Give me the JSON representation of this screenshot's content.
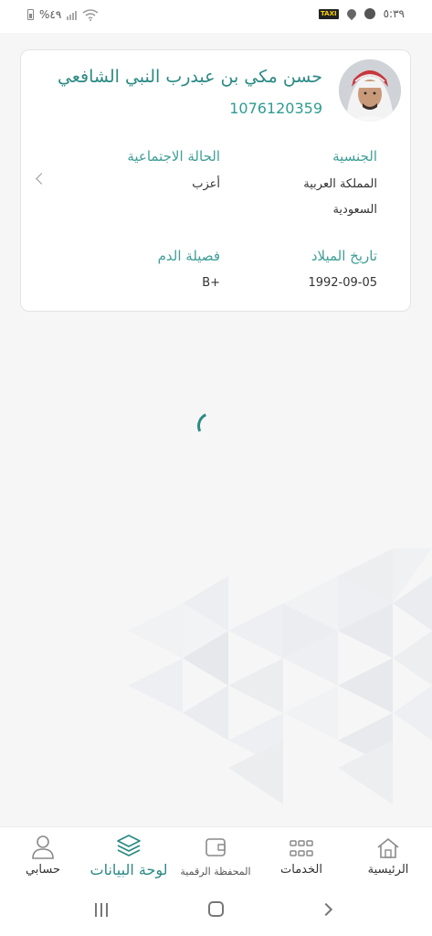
{
  "status_bar": {
    "battery_pct": "%٤٩",
    "time": "٥:٣٩",
    "taxi_badge": "TAXI"
  },
  "profile": {
    "name": "حسن مكي بن عبدرب النبي الشافعي",
    "id_number": "1076120359",
    "nationality_label": "الجنسية",
    "nationality_line1": "المملكة العربية",
    "nationality_line2": "السعودية",
    "marital_label": "الحالة الاجتماعية",
    "marital_value": "أعزب",
    "dob_label": "تاريخ الميلاد",
    "dob_value": "1992-09-05",
    "blood_label": "فصيلة الدم",
    "blood_value": "B+"
  },
  "bottom_nav": {
    "items": [
      {
        "label": "الرئيسية",
        "icon": "home-icon"
      },
      {
        "label": "الخدمات",
        "icon": "grid-icon"
      },
      {
        "label": "المحفظة الرقمية",
        "icon": "wallet-icon"
      },
      {
        "label": "لوحة البيانات",
        "icon": "layers-icon",
        "active": true
      },
      {
        "label": "حسابي",
        "icon": "user-icon"
      }
    ]
  },
  "colors": {
    "accent": "#2a8a83",
    "background": "#f6f6f7",
    "card": "#ffffff"
  }
}
